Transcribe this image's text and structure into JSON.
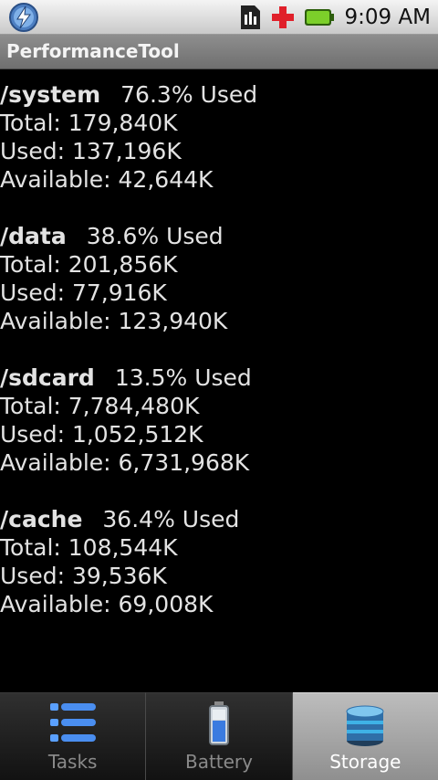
{
  "status_bar": {
    "time": "9:09 AM",
    "icons": [
      "lightning-app-icon",
      "sim-card-icon",
      "red-cross-icon",
      "battery-icon"
    ]
  },
  "app": {
    "title": "PerformanceTool"
  },
  "filesystems": [
    {
      "name": "/system",
      "percent": "76.3% Used",
      "total": "Total: 179,840K",
      "used": "Used: 137,196K",
      "available": "Available: 42,644K"
    },
    {
      "name": "/data",
      "percent": "38.6% Used",
      "total": "Total: 201,856K",
      "used": "Used: 77,916K",
      "available": "Available: 123,940K"
    },
    {
      "name": "/sdcard",
      "percent": "13.5% Used",
      "total": "Total: 7,784,480K",
      "used": "Used: 1,052,512K",
      "available": "Available: 6,731,968K"
    },
    {
      "name": "/cache",
      "percent": "36.4% Used",
      "total": "Total: 108,544K",
      "used": "Used: 39,536K",
      "available": "Available: 69,008K"
    }
  ],
  "tabs": [
    {
      "label": "Tasks",
      "icon": "list-icon",
      "active": false
    },
    {
      "label": "Battery",
      "icon": "battery-tab-icon",
      "active": false
    },
    {
      "label": "Storage",
      "icon": "storage-icon",
      "active": true
    }
  ],
  "colors": {
    "background": "#000000",
    "text": "#e3e3e3",
    "titlebar": "#7d7d7d",
    "active_tab": "#a8a8a8"
  }
}
